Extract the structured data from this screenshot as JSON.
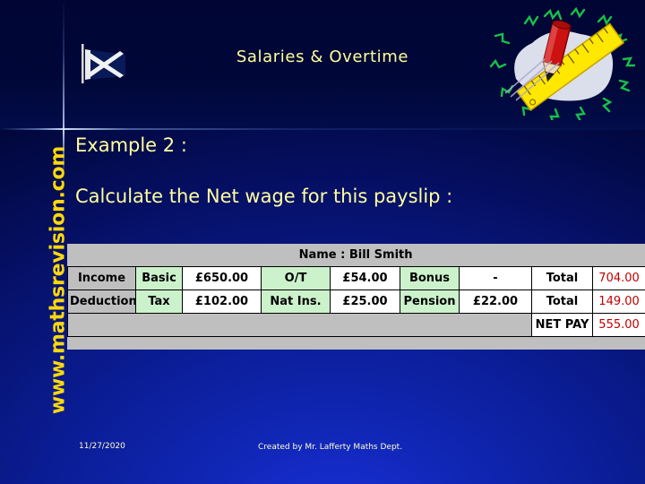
{
  "slide": {
    "title": "Salaries & Overtime",
    "example_label": "Example 2 :",
    "instruction": "Calculate the Net wage for this payslip :",
    "site_url": "www.mathsrevision.com",
    "footer_date": "11/27/2020",
    "footer_credit": "Created by Mr. Lafferty Maths Dept.",
    "colors": {
      "background_deep": "#000428",
      "background_mid": "#1026b4",
      "title_text": "#ffff99",
      "body_text": "#ffff9e",
      "url_text": "#ffd90a",
      "table_header_gray": "#bfbfbf",
      "table_label_green": "#ccf2cc",
      "table_value_white": "#ffffff",
      "total_red": "#c00000",
      "footer_text": "#ffffcc"
    }
  },
  "icons": {
    "flag": "scotland-saltire-flag-icon",
    "clipart": "ruler-and-pencil-clipart-icon"
  },
  "payslip": {
    "name_label": "Name  :  Bill  Smith",
    "rows": [
      {
        "category": "Income",
        "item1_label": "Basic",
        "item1_value": "£650.00",
        "item2_label": "O/T",
        "item2_value": "£54.00",
        "item3_label": "Bonus",
        "item3_value": "-",
        "total_label": "Total",
        "total_value": "704.00"
      },
      {
        "category": "Deductions",
        "item1_label": "Tax",
        "item1_value": "£102.00",
        "item2_label": "Nat Ins.",
        "item2_value": "£25.00",
        "item3_label": "Pension",
        "item3_value": "£22.00",
        "total_label": "Total",
        "total_value": "149.00"
      }
    ],
    "net_pay_label": "NET PAY",
    "net_pay_value": "555.00"
  }
}
